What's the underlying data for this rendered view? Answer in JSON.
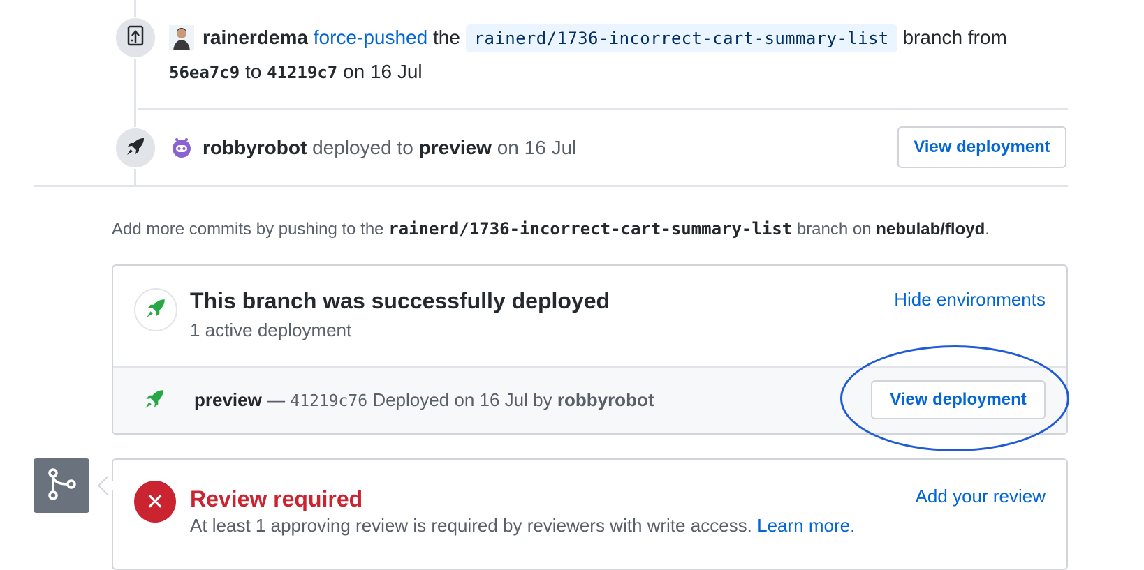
{
  "timeline": {
    "force_push": {
      "actor": "rainerdema",
      "action": "force-pushed",
      "the": "the",
      "branch": "rainerd/1736-incorrect-cart-summary-list",
      "branch_from": "branch from",
      "from_sha": "56ea7c9",
      "to_word": "to",
      "to_sha": "41219c7",
      "date": "on 16 Jul",
      "icon": "repo-push-icon"
    },
    "deploy_event": {
      "actor": "robbyrobot",
      "action": "deployed to",
      "environment": "preview",
      "date": "on 16 Jul",
      "button_label": "View deployment",
      "icon": "rocket-icon"
    }
  },
  "hint": {
    "prefix": "Add more commits by pushing to the",
    "branch": "rainerd/1736-incorrect-cart-summary-list",
    "middle": "branch on",
    "repo": "nebulab/floyd",
    "suffix": "."
  },
  "deployments": {
    "title": "This branch was successfully deployed",
    "subtitle": "1 active deployment",
    "toggle_label": "Hide environments",
    "row": {
      "environment": "preview",
      "dash": "—",
      "sha": "41219c76",
      "deployed_text": "Deployed on 16 Jul by",
      "deployer": "robbyrobot",
      "button_label": "View deployment"
    }
  },
  "review": {
    "title": "Review required",
    "description": "At least 1 approving review is required by reviewers with write access.",
    "learn_more": "Learn more.",
    "action_label": "Add your review"
  },
  "colors": {
    "link": "#0366d6",
    "success_green": "#28a745",
    "danger_red": "#cb2431",
    "annotation_blue": "#1f5bd6"
  }
}
